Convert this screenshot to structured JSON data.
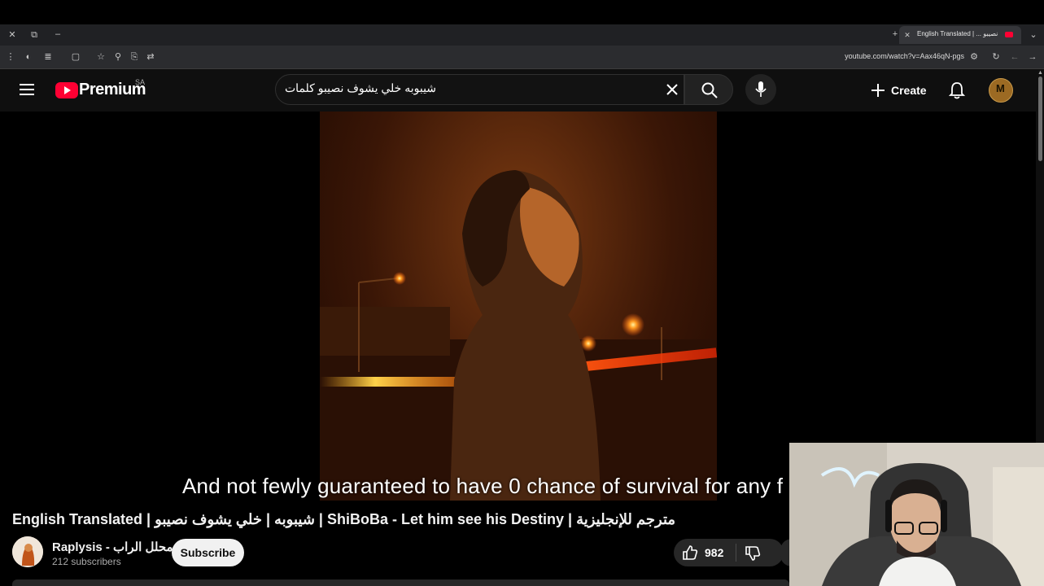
{
  "browser": {
    "tab_title": "English Translated | ... نصيبو",
    "url": "youtube.com/watch?v=Aax46qN-pgs"
  },
  "youtube": {
    "logo_text": "Premium",
    "region": "SA",
    "search": {
      "value": "شيبوبه خلي يشوف نصيبو كلمات"
    },
    "create_label": "Create",
    "avatar_letter": "M"
  },
  "video": {
    "caption": "And not fewly guaranteed to have 0 chance of survival for any f",
    "title": "English Translated | شيبوبه | خلي يشوف نصيبو | ShiBoBa - Let him see his Destiny | مترجم للإنجليزية",
    "channel": {
      "name": "Raplysis - محلل الراب",
      "subscribers": "212 subscribers",
      "subscribe_label": "Subscribe"
    },
    "likes": "982"
  },
  "colors": {
    "youtube_red": "#ff0033",
    "header_bg": "#0f0f0f",
    "button_bg": "#272727",
    "subscribe_bg": "#f1f1f1"
  }
}
